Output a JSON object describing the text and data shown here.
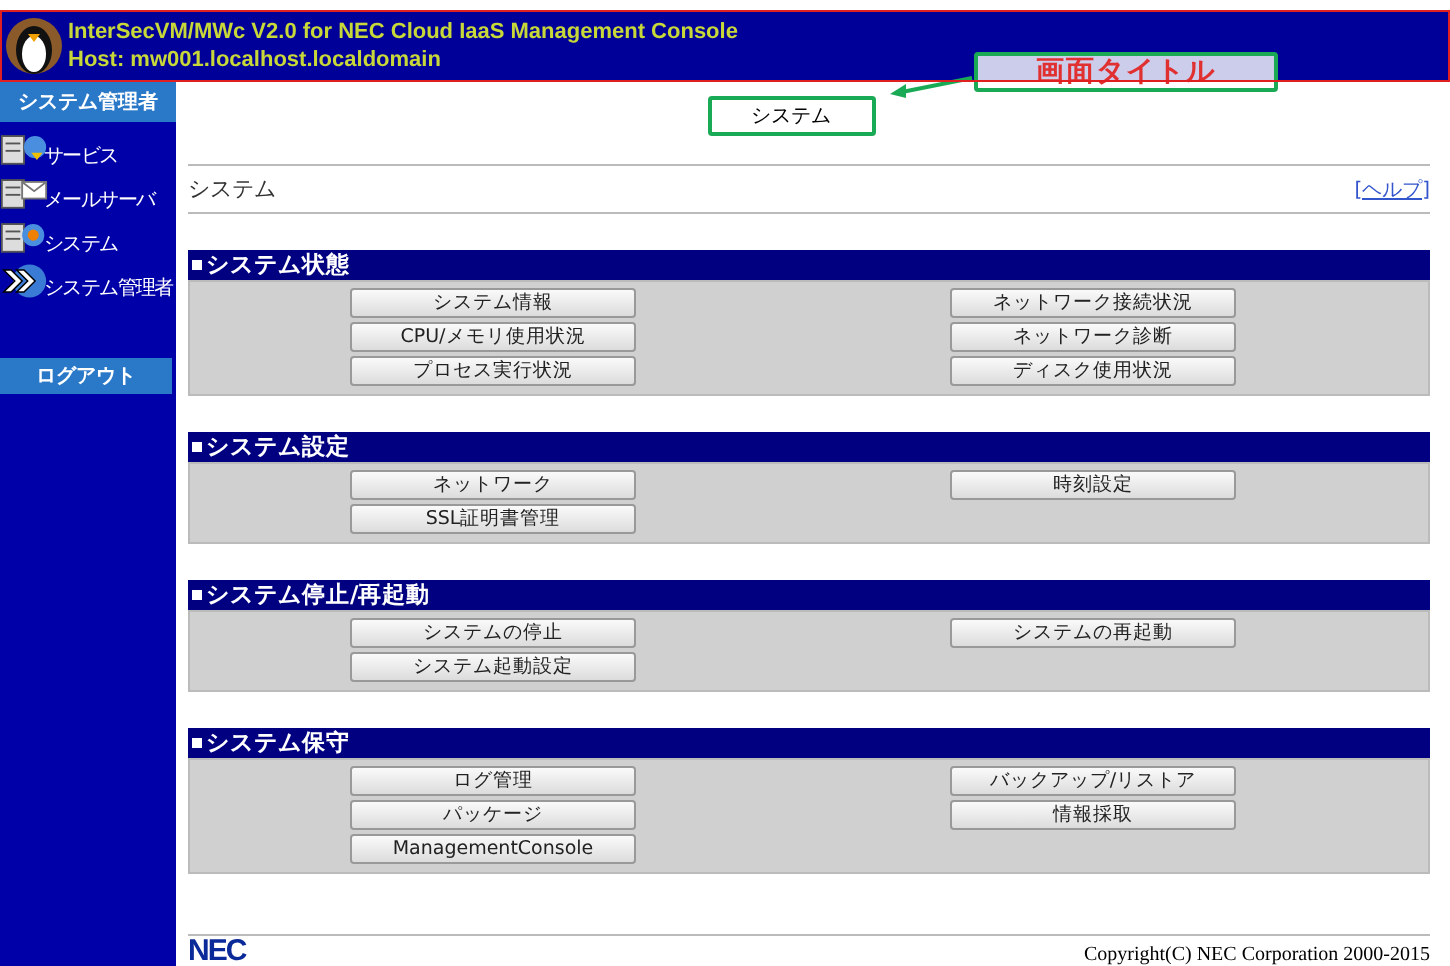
{
  "header": {
    "title": "InterSecVM/MWc V2.0 for NEC Cloud IaaS Management Console",
    "host": "Host: mw001.localhost.localdomain"
  },
  "sidebar": {
    "heading": "システム管理者",
    "items": [
      {
        "label": "サービス",
        "kind": "service"
      },
      {
        "label": "メールサーバ",
        "kind": "mail"
      },
      {
        "label": "システム",
        "kind": "system"
      },
      {
        "label": "システム管理者",
        "kind": "admin"
      }
    ],
    "logout": "ログアウト"
  },
  "page_title": "システム",
  "annotation": {
    "label": "画面タイトル"
  },
  "breadcrumb": "システム",
  "help_link": "[ヘルプ]",
  "sections": [
    {
      "title": "システム状態",
      "left": [
        "システム情報",
        "CPU/メモリ使用状況",
        "プロセス実行状況"
      ],
      "right": [
        "ネットワーク接続状況",
        "ネットワーク診断",
        "ディスク使用状況"
      ]
    },
    {
      "title": "システム設定",
      "left": [
        "ネットワーク",
        "SSL証明書管理"
      ],
      "right": [
        "時刻設定"
      ]
    },
    {
      "title": "システム停止/再起動",
      "left": [
        "システムの停止",
        "システム起動設定"
      ],
      "right": [
        "システムの再起動"
      ]
    },
    {
      "title": "システム保守",
      "left": [
        "ログ管理",
        "パッケージ",
        "ManagementConsole"
      ],
      "right": [
        "バックアップ/リストア",
        "情報採取"
      ]
    }
  ],
  "footer": {
    "logo": "NEC",
    "copyright": "Copyright(C) NEC Corporation 2000-2015"
  }
}
